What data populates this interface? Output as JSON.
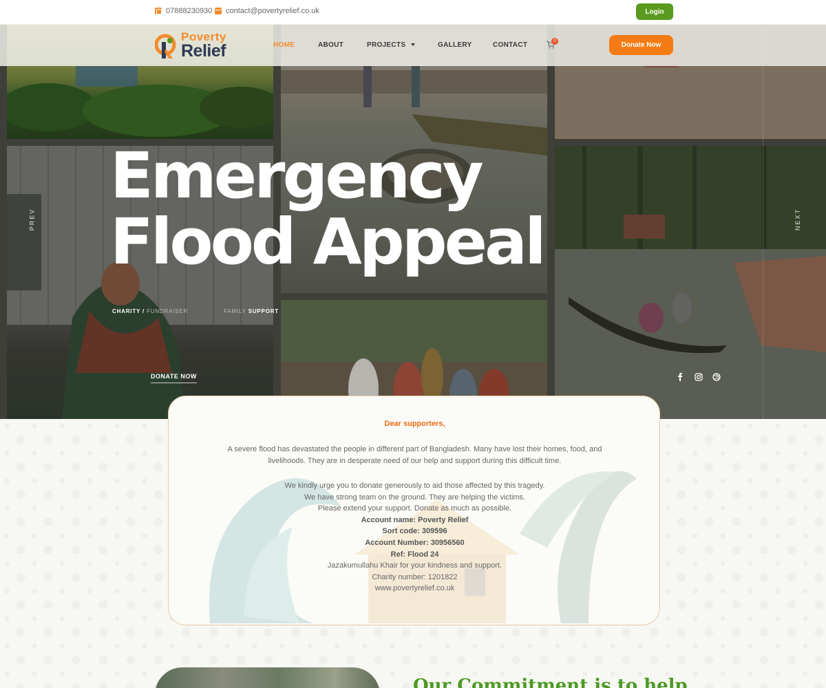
{
  "topbar": {
    "phone": "07888230930",
    "email": "contact@povertyrelief.co.uk",
    "login_label": "Login",
    "icons": [
      "phone-icon",
      "mail-icon"
    ]
  },
  "nav": {
    "logo_line1": "Poverty",
    "logo_line2": "Relief",
    "items": [
      {
        "label": "HOME",
        "active": true
      },
      {
        "label": "ABOUT",
        "active": false
      },
      {
        "label": "PROJECTS",
        "active": false
      },
      {
        "label": "GALLERY",
        "active": false
      },
      {
        "label": "CONTACT",
        "active": false
      }
    ],
    "cart_count": "0",
    "donate_label": "Donate Now"
  },
  "hero": {
    "title_line1": "Emergency",
    "title_line2": "Flood Appeal",
    "prev_label": "PREV",
    "next_label": "NEXT",
    "tag1_a": "CHARITY",
    "tag1_sep": " / ",
    "tag1_b": "FUNDRAISER",
    "tag2_a": "FAMILY",
    "tag2_b": "SUPPORT",
    "donate_label": "DONATE NOW",
    "social_icons": [
      "facebook-icon",
      "instagram-icon",
      "dribbble-icon"
    ]
  },
  "letter": {
    "greeting": "Dear supporters,",
    "paragraph1": "A severe flood has devastated the people in different part of Bangladesh. Many have lost their homes, food, and livelihoods. They are in desperate need of our help and support during this difficult time.",
    "line1": "We kindly urge you to donate generously to aid those affected by this tragedy.",
    "line2": "We have strong team on the ground. They are helping the victims.",
    "line3": "Please extend your support. Donate as much as possible.",
    "account_name": "Account name: Poverty Relief",
    "sort_code": "Sort code: 309596",
    "account_number": "Account Number: 30956560",
    "ref": "Ref: Flood 24",
    "thanks": "Jazakumullahu Khair for your kindness and support.",
    "charity_number": "Charity number: 1201822",
    "website": "www.povertyrelief.co.uk"
  },
  "commitment": {
    "heading": "Our Commitment is to help"
  },
  "colors": {
    "brand_orange": "#f57c14",
    "brand_green": "#5a9a1e",
    "navy": "#2f3a55"
  }
}
